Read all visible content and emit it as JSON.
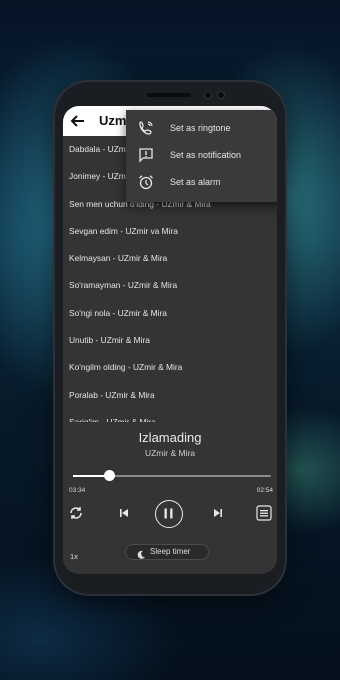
{
  "header": {
    "title": "Uzmi",
    "back_icon": "arrow-back-icon"
  },
  "songs": [
    "Dabdala - UZmir & Mira",
    "Jonimey - UZmir & Mira",
    "Sen men uchun o'lding - UZmir & Mira",
    "Sevgan edim - UZmir va Mira",
    "Kelmaysan - UZmir & Mira",
    "So'ramayman - UZmir & Mira",
    "So'ngi nola - UZmir & Mira",
    "Unutib - UZmir & Mira",
    "Ko'ngilm olding - UZmir & Mira",
    "Poralab - UZmir & Mira",
    "Sariq'im - UZmir & Mira"
  ],
  "menu": {
    "items": [
      {
        "label": "Set as ringtone",
        "icon": "phone-ring-icon"
      },
      {
        "label": "Set as notification",
        "icon": "chat-alert-icon"
      },
      {
        "label": "Set as alarm",
        "icon": "alarm-clock-icon"
      }
    ]
  },
  "player": {
    "song_title": "Izlamading",
    "artist": "UZmir & Mira",
    "current_time": "03:34",
    "total_time": "02:54",
    "progress_fraction": 0.18,
    "speed": "1x",
    "sleep_timer_label": "Sleep timer",
    "controls": [
      "repeat-icon",
      "previous-icon",
      "pause-icon",
      "next-icon",
      "playlist-icon"
    ]
  },
  "colors": {
    "background": "#343434",
    "text": "#e6e6e6",
    "accent": "#ffffff"
  }
}
